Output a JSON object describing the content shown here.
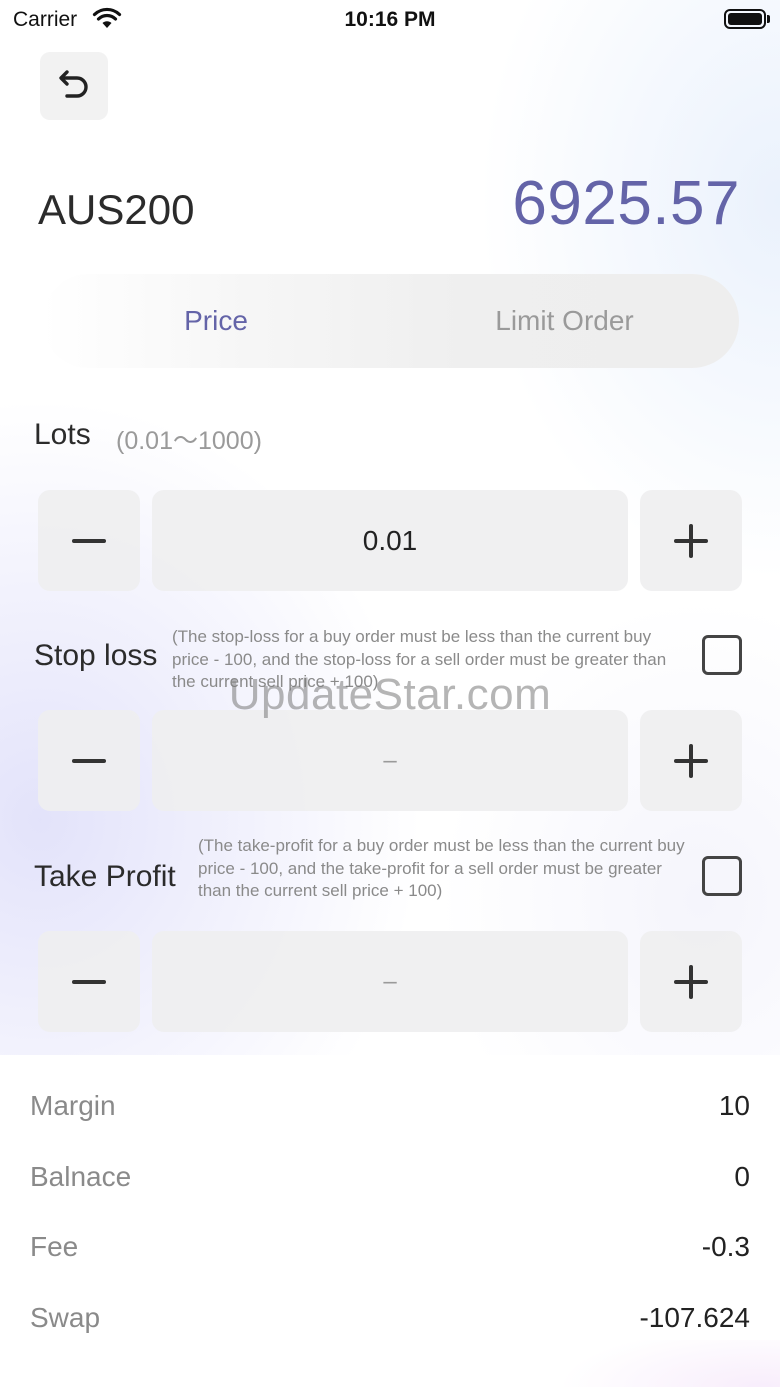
{
  "status_bar": {
    "carrier": "Carrier",
    "time": "10:16 PM"
  },
  "header": {
    "back_icon": "undo-arrow-icon",
    "symbol": "AUS200",
    "price": "6925.57",
    "price_color": "#6464a8"
  },
  "tabs": [
    {
      "label": "Price",
      "active": true
    },
    {
      "label": "Limit Order",
      "active": false
    }
  ],
  "lots": {
    "label": "Lots",
    "range": "(0.01～1000)",
    "value": "0.01"
  },
  "stop_loss": {
    "label": "Stop loss",
    "note": "(The stop-loss for a buy order must be less than the current buy price - 100, and the stop-loss for a sell order must be greater than the current sell price + 100)",
    "value": "–",
    "checked": false
  },
  "take_profit": {
    "label": "Take Profit",
    "note": "(The take-profit for a buy order must be less than the current buy price - 100, and the take-profit for a sell order must be greater than the current sell price + 100)",
    "value": "–",
    "checked": false
  },
  "watermark": "UpdateStar.com",
  "summary": {
    "margin_label": "Margin",
    "margin_value": "10",
    "balance_label": "Balnace",
    "balance_value": "0",
    "fee_label": "Fee",
    "fee_value": "-0.3",
    "swap_label": "Swap",
    "swap_value": "-107.624"
  }
}
